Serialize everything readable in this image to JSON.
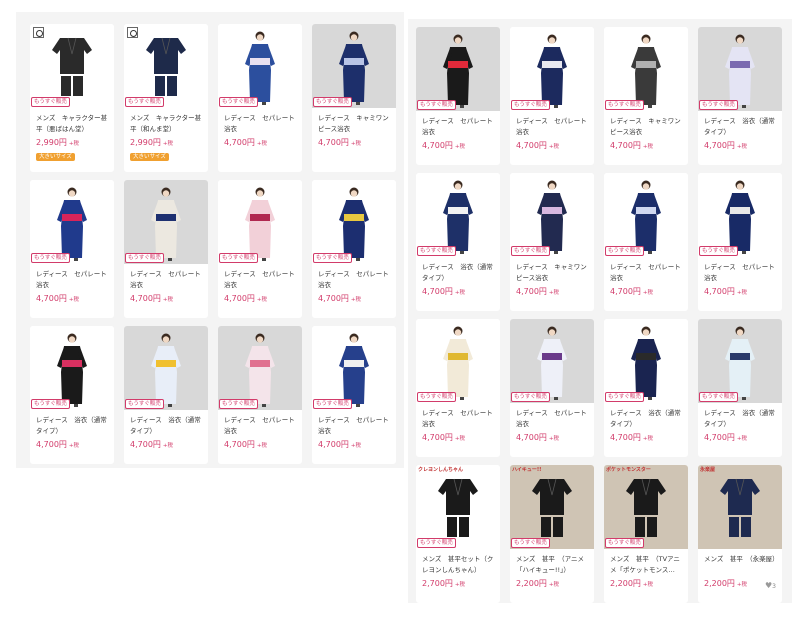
{
  "colors": {
    "accent": "#d23b6a",
    "tag_large": "#f0a030",
    "panel_bg": "#f4f4f4"
  },
  "left_grid": {
    "products": [
      {
        "name": "メンズ　キャラクター甚平（悪ばはん堂）",
        "price": "2,990円",
        "tax": "+税",
        "badge": "もうすぐ販売",
        "tag": "大きいサイズ",
        "has_logo": true,
        "bg": "white",
        "garment": "#2a2a2a",
        "sash": "#2a2a2a",
        "kind": "jinbei"
      },
      {
        "name": "メンズ　キャラクター甚平（和んま堂）",
        "price": "2,990円",
        "tax": "+税",
        "badge": "もうすぐ販売",
        "tag": "大きいサイズ",
        "has_logo": true,
        "bg": "white",
        "garment": "#1e2a4a",
        "sash": "#1e2a4a",
        "kind": "jinbei"
      },
      {
        "name": "レディース　セパレート浴衣",
        "price": "4,700円",
        "tax": "+税",
        "badge": "もうすぐ販売",
        "bg": "white",
        "garment": "#2c4f9e",
        "sash": "#e8e0f0",
        "kind": "yukata"
      },
      {
        "name": "レディース　キャミワンピース浴衣",
        "price": "4,700円",
        "tax": "+税",
        "badge": "もうすぐ販売",
        "bg": "gray",
        "garment": "#1d2f6b",
        "sash": "#b8c4e6",
        "kind": "yukata"
      },
      {
        "name": "レディース　セパレート浴衣",
        "price": "4,700円",
        "tax": "+税",
        "badge": "もうすぐ販売",
        "bg": "white",
        "garment": "#203a8c",
        "sash": "#d8245a",
        "kind": "yukata"
      },
      {
        "name": "レディース　セパレート浴衣",
        "price": "4,700円",
        "tax": "+税",
        "badge": "もうすぐ販売",
        "bg": "gray",
        "garment": "#ece8e0",
        "sash": "#1e3070",
        "kind": "yukata"
      },
      {
        "name": "レディース　セパレート浴衣",
        "price": "4,700円",
        "tax": "+税",
        "badge": "もうすぐ販売",
        "bg": "white",
        "garment": "#f2d0d8",
        "sash": "#b02850",
        "kind": "yukata"
      },
      {
        "name": "レディース　セパレート浴衣",
        "price": "4,700円",
        "tax": "+税",
        "badge": "もうすぐ販売",
        "bg": "white",
        "garment": "#1c2e70",
        "sash": "#e8c840",
        "kind": "yukata"
      },
      {
        "name": "レディース　浴衣（通常タイプ）",
        "price": "4,700円",
        "tax": "+税",
        "badge": "もうすぐ販売",
        "bg": "white",
        "garment": "#1a1a1a",
        "sash": "#d83060",
        "kind": "yukata"
      },
      {
        "name": "レディース　浴衣（通常タイプ）",
        "price": "4,700円",
        "tax": "+税",
        "badge": "もうすぐ販売",
        "bg": "gray",
        "garment": "#e8eef8",
        "sash": "#f0c030",
        "kind": "yukata"
      },
      {
        "name": "レディース　セパレート浴衣",
        "price": "4,700円",
        "tax": "+税",
        "badge": "もうすぐ販売",
        "bg": "gray",
        "garment": "#f4e4ea",
        "sash": "#e07090",
        "kind": "yukata"
      },
      {
        "name": "レディース　セパレート浴衣",
        "price": "4,700円",
        "tax": "+税",
        "badge": "もうすぐ販売",
        "bg": "white",
        "garment": "#26408c",
        "sash": "#f0f0f0",
        "kind": "yukata"
      }
    ]
  },
  "right_grid": {
    "products": [
      {
        "name": "レディース　セパレート浴衣",
        "price": "4,700円",
        "tax": "+税",
        "badge": "もうすぐ販売",
        "bg": "gray",
        "garment": "#1a1a1a",
        "sash": "#e02a3a",
        "kind": "yukata"
      },
      {
        "name": "レディース　セパレート浴衣",
        "price": "4,700円",
        "tax": "+税",
        "badge": "もうすぐ販売",
        "bg": "white",
        "garment": "#1c2a5e",
        "sash": "#e8e8f0",
        "kind": "yukata"
      },
      {
        "name": "レディース　キャミワンピース浴衣",
        "price": "4,700円",
        "tax": "+税",
        "badge": "もうすぐ販売",
        "bg": "white",
        "garment": "#3a3a3a",
        "sash": "#b0b0b0",
        "kind": "yukata"
      },
      {
        "name": "レディース　浴衣（通常タイプ）",
        "price": "4,700円",
        "tax": "+税",
        "badge": "もうすぐ販売",
        "bg": "gray",
        "garment": "#e4e4f4",
        "sash": "#7a6ab0",
        "kind": "yukata"
      },
      {
        "name": "レディース　浴衣（通常タイプ）",
        "price": "4,700円",
        "tax": "+税",
        "badge": "もうすぐ販売",
        "bg": "white",
        "garment": "#1e3068",
        "sash": "#f2f2f2",
        "kind": "yukata"
      },
      {
        "name": "レディース　キャミワンピース浴衣",
        "price": "4,700円",
        "tax": "+税",
        "badge": "もうすぐ販売",
        "bg": "white",
        "garment": "#222a50",
        "sash": "#d8b8e0",
        "kind": "yukata"
      },
      {
        "name": "レディース　セパレート浴衣",
        "price": "4,700円",
        "tax": "+税",
        "badge": "もうすぐ販売",
        "bg": "white",
        "garment": "#1c2e6a",
        "sash": "#d0d8f0",
        "kind": "yukata"
      },
      {
        "name": "レディース　セパレート浴衣",
        "price": "4,700円",
        "tax": "+税",
        "badge": "もうすぐ販売",
        "bg": "white",
        "garment": "#182a66",
        "sash": "#e8e8e8",
        "kind": "yukata"
      },
      {
        "name": "レディース　セパレート浴衣",
        "price": "4,700円",
        "tax": "+税",
        "badge": "もうすぐ販売",
        "bg": "white",
        "garment": "#f2ead8",
        "sash": "#e0b830",
        "kind": "yukata"
      },
      {
        "name": "レディース　セパレート浴衣",
        "price": "4,700円",
        "tax": "+税",
        "badge": "もうすぐ販売",
        "bg": "gray",
        "garment": "#eef0f8",
        "sash": "#6a3a8a",
        "kind": "yukata"
      },
      {
        "name": "レディース　浴衣（通常タイプ）",
        "price": "4,700円",
        "tax": "+税",
        "badge": "もうすぐ販売",
        "bg": "white",
        "garment": "#1a2450",
        "sash": "#2a2a2a",
        "kind": "yukata"
      },
      {
        "name": "レディース　浴衣（通常タイプ）",
        "price": "4,700円",
        "tax": "+税",
        "badge": "もうすぐ販売",
        "bg": "gray",
        "garment": "#e4f0f6",
        "sash": "#2a3a6a",
        "kind": "yukata"
      },
      {
        "name": "メンズ　甚平セット（クレヨンしんちゃん）",
        "price": "2,700円",
        "tax": "+税",
        "badge": "もうすぐ販売",
        "bg": "white",
        "garment": "#1a1a1a",
        "sash": "#1a1a1a",
        "kind": "jinbei",
        "brand": "クレヨンしんちゃん"
      },
      {
        "name": "メンズ　甚平　（アニメ「ハイキュー!!」）",
        "price": "2,200円",
        "tax": "+税",
        "badge": "もうすぐ販売",
        "bg": "photo",
        "garment": "#1a1a1a",
        "sash": "#1a1a1a",
        "kind": "jinbei",
        "brand": "ハイキュー!!"
      },
      {
        "name": "メンズ　甚平　（TVアニメ「ポケットモンス…",
        "price": "2,200円",
        "tax": "+税",
        "badge": "もうすぐ販売",
        "bg": "photo",
        "garment": "#1a1a1a",
        "sash": "#1a1a1a",
        "kind": "jinbei",
        "brand": "ポケットモンスター"
      },
      {
        "name": "メンズ　甚平　（永楽屋）",
        "price": "2,200円",
        "tax": "+税",
        "badge": null,
        "bg": "photo",
        "garment": "#1e2a50",
        "sash": "#1e2a50",
        "kind": "jinbei",
        "brand": "永楽屋",
        "favorites": "3"
      }
    ]
  }
}
